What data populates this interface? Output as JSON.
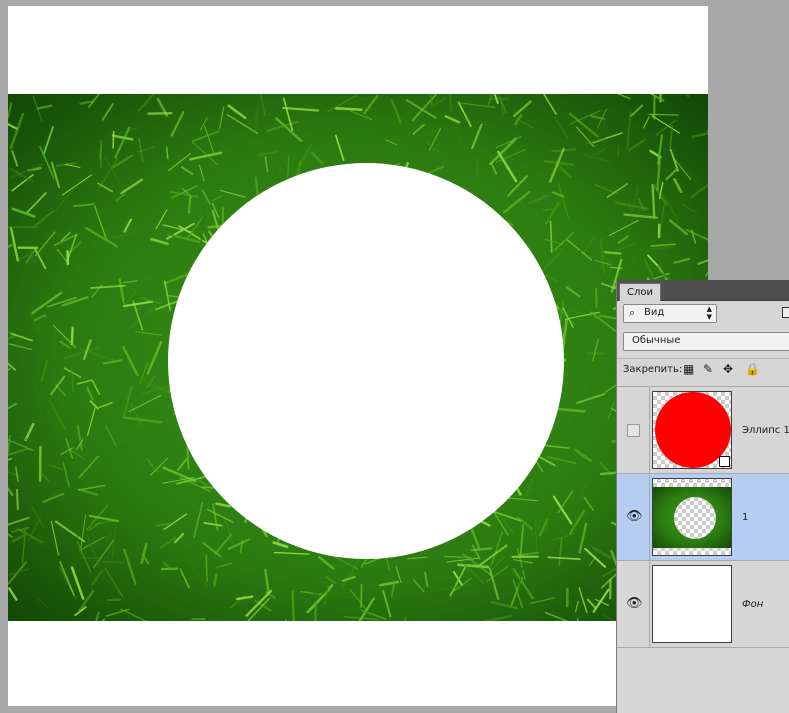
{
  "canvas": {
    "background": "#ffffff",
    "photo": "green grass texture",
    "cutout": "white circular hole"
  },
  "layers_panel": {
    "tab_label": "Слои",
    "filter": {
      "icon": "search-icon",
      "value": "Вид",
      "arrows": "⇕"
    },
    "blend_mode": "Обычные",
    "lock_label": "Закрепить:",
    "lock_icons": [
      "lock-transparent-pixels-icon",
      "lock-image-pixels-icon",
      "lock-position-icon",
      "lock-all-icon"
    ],
    "layers": [
      {
        "name": "Эллипс 1",
        "visible": false,
        "selected": false,
        "thumb": "red circle shape",
        "fill": "#ff0000"
      },
      {
        "name": "1",
        "visible": true,
        "selected": true,
        "thumb": "grass with transparent circle"
      },
      {
        "name": "Фон",
        "visible": true,
        "selected": false,
        "thumb": "white background"
      }
    ],
    "selection_color": "#b6cdf2"
  }
}
